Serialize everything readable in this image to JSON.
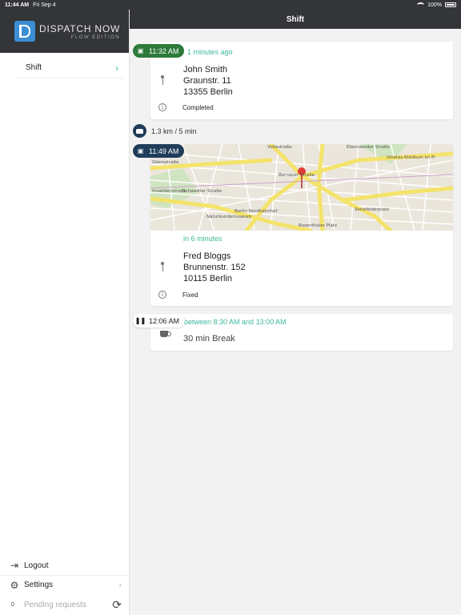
{
  "status_bar": {
    "time": "11:44 AM",
    "date": "Fri Sep 4",
    "battery": "100%"
  },
  "brand": {
    "name": "DISPATCH NOW",
    "edition": "FLOW EDITION",
    "color": "#3b8ed4"
  },
  "sidebar": {
    "items": [
      {
        "label": "Shift",
        "active": true
      }
    ],
    "logout": "Logout",
    "settings": "Settings",
    "pending_count": "0",
    "pending_label": "Pending requests"
  },
  "header": {
    "title": "Shift"
  },
  "stops": [
    {
      "time": "11:32 AM",
      "eta": "1 minutes ago",
      "name": "John Smith",
      "street": "Graunstr. 11",
      "city": "13355 Berlin",
      "status": "Completed",
      "badge_color": "#2d7a3a"
    },
    {
      "time": "11:49 AM",
      "eta": "in 6 minutes",
      "name": "Fred Bloggs",
      "street": "Brunnenstr. 152",
      "city": "10115 Berlin",
      "status": "Fixed",
      "badge_color": "#1f3d5a"
    }
  ],
  "drive": {
    "text": "1.3 km / 5 min"
  },
  "map_labels": {
    "l1": "Vollastraße",
    "l2": "Eberswalder Straße",
    "l3": "Vinetas Klinikum im Fr",
    "l4": "Bernauer Straße",
    "l5": "Schwedter Straße",
    "l6": "Invalidenstraße",
    "l7": "Berlin Nordbahnhof",
    "l8": "Naturkundemuseum",
    "l9": "Senefelderplatz",
    "l10": "Rosenthaler Platz",
    "l11": "Gleimstraße"
  },
  "break": {
    "time": "12:06 AM",
    "window": "between 8:30 AM and 13:00 AM",
    "label": "30 min Break"
  }
}
